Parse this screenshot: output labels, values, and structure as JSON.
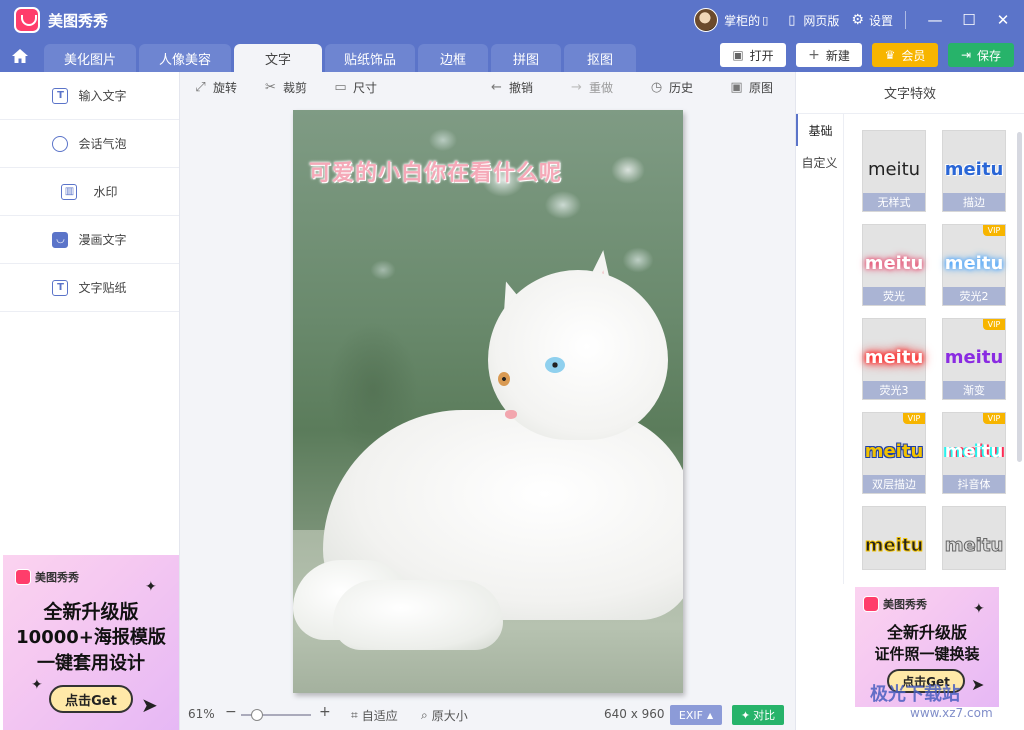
{
  "app": {
    "name": "美图秀秀"
  },
  "titlebar": {
    "user": "掌柜的",
    "web_version": "网页版",
    "settings": "设置",
    "minimize": "—",
    "maximize": "☐",
    "close": "✕"
  },
  "tabs": [
    {
      "label": "美化图片"
    },
    {
      "label": "人像美容"
    },
    {
      "label": "文字"
    },
    {
      "label": "贴纸饰品"
    },
    {
      "label": "边框"
    },
    {
      "label": "拼图"
    },
    {
      "label": "抠图"
    }
  ],
  "actions": {
    "open": "打开",
    "new": "新建",
    "vip": "会员",
    "save": "保存"
  },
  "sidebar": {
    "items": [
      {
        "label": "输入文字",
        "icon": "T"
      },
      {
        "label": "会话气泡",
        "icon": "◯"
      },
      {
        "label": "水印",
        "icon": "印"
      },
      {
        "label": "漫画文字",
        "icon": "◉"
      },
      {
        "label": "文字贴纸",
        "icon": "T"
      }
    ]
  },
  "ad_left": {
    "brand": "美图秀秀",
    "line1": "全新升级版",
    "line2": "10000+海报模版",
    "line3": "一键套用设计",
    "cta": "点击Get"
  },
  "ad_right": {
    "brand": "美图秀秀",
    "line1": "全新升级版",
    "line2": "证件照一键换装",
    "cta": "点击Get"
  },
  "toolbar": {
    "rotate": "旋转",
    "crop": "裁剪",
    "size": "尺寸",
    "undo": "撤销",
    "redo": "重做",
    "history": "历史",
    "original": "原图"
  },
  "canvas": {
    "overlay_text": "可爱的小白你在看什么呢"
  },
  "bottombar": {
    "zoom": "61%",
    "minus": "−",
    "plus": "+",
    "fit": "自适应",
    "actual": "原大小",
    "dimensions": "640 x 960",
    "exif": "EXIF",
    "compare": "对比"
  },
  "right_panel": {
    "title": "文字特效",
    "categories": [
      {
        "label": "基础"
      },
      {
        "label": "自定义"
      }
    ],
    "effects": [
      {
        "sample": "meitu",
        "label": "无样式",
        "vip": ""
      },
      {
        "sample": "meitu",
        "label": "描边",
        "vip": ""
      },
      {
        "sample": "meitu",
        "label": "荧光",
        "vip": ""
      },
      {
        "sample": "meitu",
        "label": "荧光2",
        "vip": "VIP"
      },
      {
        "sample": "meitu",
        "label": "荧光3",
        "vip": ""
      },
      {
        "sample": "meitu",
        "label": "渐变",
        "vip": "VIP"
      },
      {
        "sample": "meitu",
        "label": "双层描边",
        "vip": "VIP"
      },
      {
        "sample": "meitu",
        "label": "抖音体",
        "vip": "VIP"
      },
      {
        "sample": "meitu",
        "label": "",
        "vip": ""
      },
      {
        "sample": "meitu",
        "label": "",
        "vip": ""
      }
    ]
  },
  "watermark": {
    "line1": "极光下载站",
    "line2": "www.xz7.com"
  },
  "colors": {
    "accent": "#5b74c9",
    "save": "#27b36a",
    "vip": "#f7b500",
    "text_overlay": "#f5a9b8"
  }
}
